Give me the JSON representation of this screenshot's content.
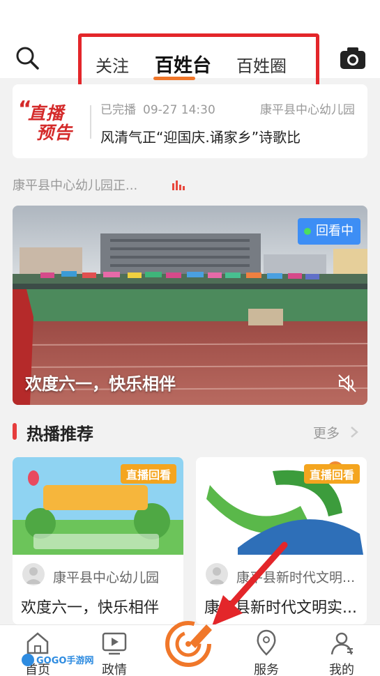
{
  "header": {
    "tabs": [
      {
        "label": "关注",
        "active": false
      },
      {
        "label": "百姓台",
        "active": true
      },
      {
        "label": "百姓圈",
        "active": false
      }
    ],
    "search_icon": "search-icon",
    "camera_icon": "camera-icon"
  },
  "live_notice": {
    "logo_line1": "直播",
    "logo_line2": "预告",
    "status": "已完播",
    "time": "09-27 14:30",
    "org": "康平县中心幼儿园",
    "title": "风清气正“迎国庆.诵家乡”诗歌比"
  },
  "channel": {
    "label": "康平县中心幼儿园正..."
  },
  "featured_video": {
    "badge": "回看中",
    "title": "欢度六一，快乐相伴",
    "mute_icon": "mute-icon"
  },
  "section": {
    "title": "热播推荐",
    "more": "更多"
  },
  "cards": [
    {
      "badge": "直播回看",
      "org": "康平县中心幼儿园",
      "title": "欢度六一，快乐相伴"
    },
    {
      "badge": "直播回看",
      "org": "康平县新时代文明...",
      "title": "康平县新时代文明实..."
    }
  ],
  "tabbar": {
    "items": [
      {
        "label": "首页",
        "icon": "home-icon"
      },
      {
        "label": "政情",
        "icon": "tv-icon"
      },
      {
        "label": "",
        "icon": "live-center-icon"
      },
      {
        "label": "服务",
        "icon": "location-icon"
      },
      {
        "label": "我的",
        "icon": "user-icon"
      }
    ]
  },
  "colors": {
    "accent": "#f0772a",
    "highlight_red": "#e3262a",
    "badge_blue": "#3d8ef5",
    "badge_orange": "#f4a51f"
  }
}
